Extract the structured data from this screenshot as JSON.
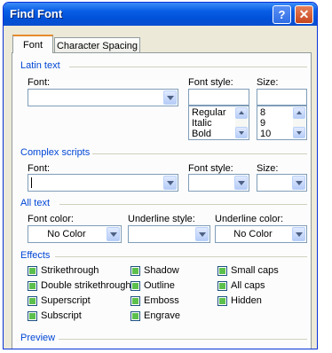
{
  "window": {
    "title": "Find Font",
    "help_glyph": "?",
    "close_glyph": "✕"
  },
  "tabs": [
    {
      "label": "Font",
      "selected": true
    },
    {
      "label": "Character Spacing",
      "selected": false
    }
  ],
  "latin": {
    "title": "Latin text",
    "font_label": "Font:",
    "font_value": "",
    "style_label": "Font style:",
    "style_value": "",
    "style_list": [
      "Regular",
      "Italic",
      "Bold"
    ],
    "size_label": "Size:",
    "size_value": "",
    "size_list": [
      "8",
      "9",
      "10"
    ]
  },
  "complex": {
    "title": "Complex scripts",
    "font_label": "Font:",
    "font_value": "",
    "style_label": "Font style:",
    "style_value": "",
    "size_label": "Size:",
    "size_value": ""
  },
  "alltext": {
    "title": "All text",
    "color_label": "Font color:",
    "color_value": "No Color",
    "underline_label": "Underline style:",
    "underline_value": "",
    "underline_color_label": "Underline color:",
    "underline_color_value": "No Color"
  },
  "effects": {
    "title": "Effects",
    "col1": [
      "Strikethrough",
      "Double strikethrough",
      "Superscript",
      "Subscript"
    ],
    "col2": [
      "Shadow",
      "Outline",
      "Emboss",
      "Engrave"
    ],
    "col3": [
      "Small caps",
      "All caps",
      "Hidden"
    ]
  },
  "preview": {
    "title": "Preview"
  },
  "colors": {
    "titlebar": "#0a5fe6",
    "section_title": "#0046d5",
    "checkbox_fill": "#5cc04c",
    "tab_highlight": "#e68b2c"
  }
}
